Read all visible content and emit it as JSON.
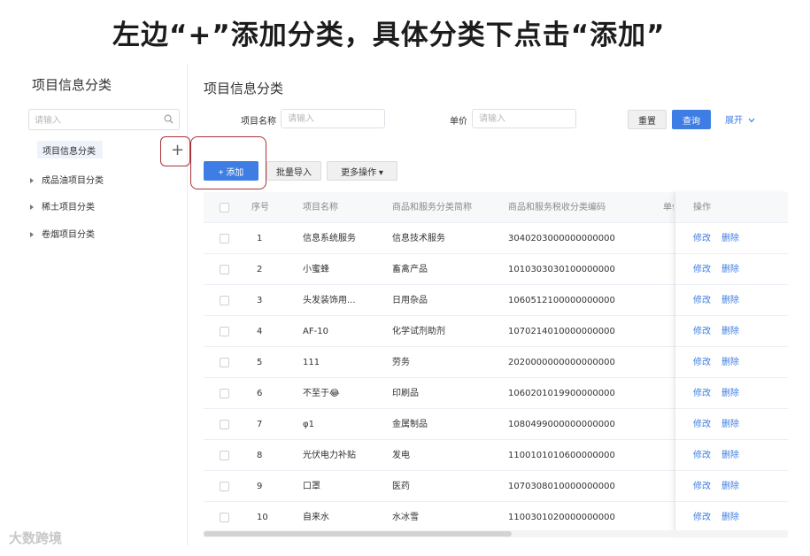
{
  "banner": {
    "title": "左边“+”添加分类，具体分类下点击“添加”"
  },
  "sidebar": {
    "title": "项目信息分类",
    "search_placeholder": "请输入",
    "active_item": "项目信息分类",
    "items": [
      {
        "label": "成品油项目分类"
      },
      {
        "label": "稀土项目分类"
      },
      {
        "label": "卷烟项目分类"
      }
    ]
  },
  "main": {
    "title": "项目信息分类",
    "filters": {
      "name_label": "项目名称",
      "name_placeholder": "请输入",
      "price_label": "单价",
      "price_placeholder": "请输入"
    },
    "buttons": {
      "reset": "重置",
      "query": "查询",
      "expand": "展开",
      "add": "+ 添加",
      "batch_import": "批量导入",
      "more_ops": "更多操作 ▾"
    }
  },
  "table": {
    "headers": {
      "seq": "序号",
      "name": "项目名称",
      "category": "商品和服务分类简称",
      "tax_code": "商品和服务税收分类编码",
      "price": "单价",
      "ops": "操作"
    },
    "edit_label": "修改",
    "delete_label": "删除",
    "rows": [
      {
        "seq": "1",
        "name": "信息系统服务",
        "category": "信息技术服务",
        "tax_code": "3040203000000000000"
      },
      {
        "seq": "2",
        "name": "小蜜蜂",
        "category": "畜禽产品",
        "tax_code": "1010303030100000000"
      },
      {
        "seq": "3",
        "name": "头发装饰用...",
        "category": "日用杂品",
        "tax_code": "1060512100000000000"
      },
      {
        "seq": "4",
        "name": "AF-10",
        "category": "化学试剂助剂",
        "tax_code": "1070214010000000000"
      },
      {
        "seq": "5",
        "name": "111",
        "category": "劳务",
        "tax_code": "2020000000000000000"
      },
      {
        "seq": "6",
        "name": "不至于😂",
        "category": "印刷品",
        "tax_code": "1060201019900000000"
      },
      {
        "seq": "7",
        "name": "φ1",
        "category": "金属制品",
        "tax_code": "1080499000000000000"
      },
      {
        "seq": "8",
        "name": "光伏电力补贴",
        "category": "发电",
        "tax_code": "1100101010600000000"
      },
      {
        "seq": "9",
        "name": "口罩",
        "category": "医药",
        "tax_code": "1070308010000000000"
      },
      {
        "seq": "10",
        "name": "自来水",
        "category": "水冰雪",
        "tax_code": "1100301020000000000"
      }
    ]
  },
  "watermark": "大数跨境",
  "colors": {
    "primary": "#3d7de4",
    "highlight_border": "#a8323a"
  }
}
